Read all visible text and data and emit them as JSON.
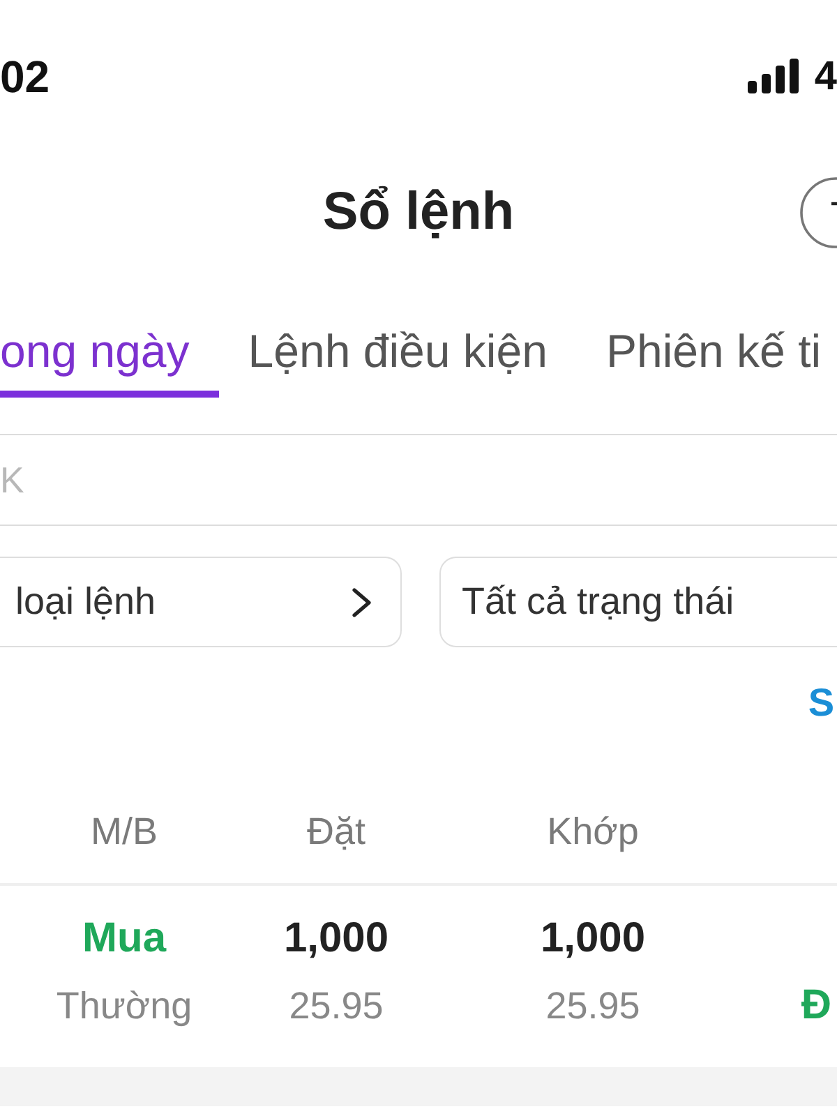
{
  "status_bar": {
    "time": "02",
    "network": "4"
  },
  "header": {
    "title": "Sổ lệnh"
  },
  "tabs": [
    {
      "label": "ong ngày",
      "selected": true
    },
    {
      "label": "Lệnh điều kiện",
      "selected": false
    },
    {
      "label": "Phiên kế ti",
      "selected": false
    }
  ],
  "search": {
    "placeholder": "K"
  },
  "filters": [
    {
      "value": "loại lệnh",
      "kind": "chevron"
    },
    {
      "value": "Tất cả trạng thái",
      "kind": "plain"
    }
  ],
  "link": {
    "label": "S"
  },
  "table": {
    "columns": [
      "M/B",
      "Đặt",
      "Khớp"
    ],
    "rows": [
      {
        "side": {
          "label": "Mua",
          "kind": "buy"
        },
        "order_type": "Thường",
        "order_qty": "1,000",
        "order_price": "25.95",
        "match_qty": "1,000",
        "match_price": "25.95",
        "status": {
          "label": "Đ",
          "kind": "filled"
        }
      }
    ]
  }
}
